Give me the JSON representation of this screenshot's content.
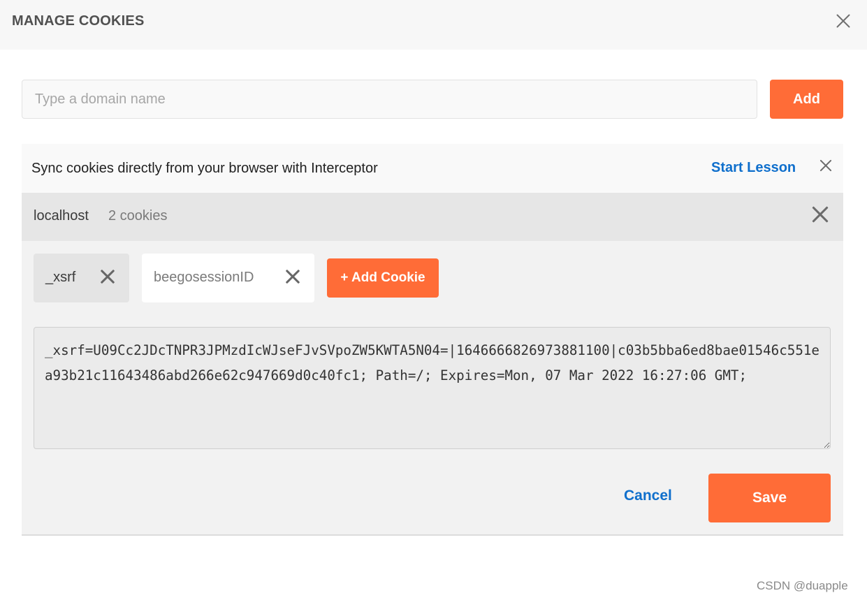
{
  "dialog": {
    "title": "MANAGE COOKIES",
    "close_icon": "close-icon"
  },
  "domain_form": {
    "placeholder": "Type a domain name",
    "value": "",
    "add_label": "Add"
  },
  "sync_banner": {
    "text": "Sync cookies directly from your browser with Interceptor",
    "link_label": "Start Lesson"
  },
  "domain_panel": {
    "domain": "localhost",
    "count": "2 cookies",
    "cookies": [
      {
        "name": "_xsrf",
        "selected": true
      },
      {
        "name": "beegosessionID",
        "selected": false
      }
    ],
    "add_cookie_label": "+ Add Cookie",
    "cookie_value": "_xsrf=U09Cc2JDcTNPR3JPMzdIcWJseFJvSVpoZW5KWTA5N04=|1646666826973881100|c03b5bba6ed8bae01546c551ea93b21c11643486abd266e62c947669d0c40fc1; Path=/; Expires=Mon, 07 Mar 2022 16:27:06 GMT;",
    "cancel_label": "Cancel",
    "save_label": "Save"
  },
  "watermark": "CSDN @duapple",
  "colors": {
    "accent": "#ff6c37",
    "link": "#0f6fcc"
  }
}
